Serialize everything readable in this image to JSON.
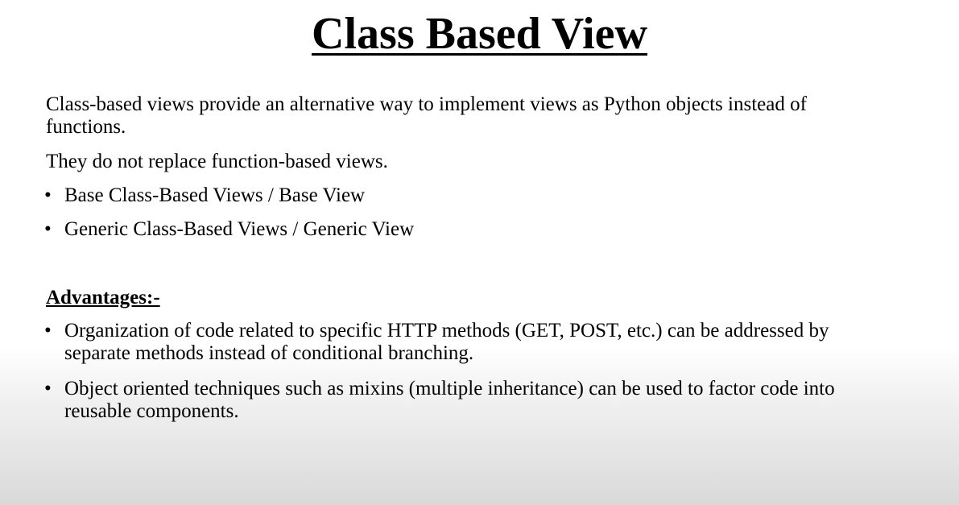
{
  "title": "Class Based View",
  "intro": {
    "lines": [
      "Class-based views provide an alternative way to implement views as Python objects instead of",
      "functions."
    ],
    "second": "They do not replace function-based views."
  },
  "types": [
    "Base Class-Based Views / Base View",
    "Generic Class-Based Views / Generic View"
  ],
  "advantages": {
    "heading": "Advantages:-",
    "items": [
      {
        "lines": [
          "Organization of code related to specific HTTP methods (GET, POST, etc.) can be addressed by",
          "separate methods instead of conditional branching."
        ]
      },
      {
        "lines": [
          "Object oriented techniques such as mixins (multiple inheritance) can be used to factor code into",
          "reusable components."
        ]
      }
    ]
  },
  "bullet_char": "•"
}
